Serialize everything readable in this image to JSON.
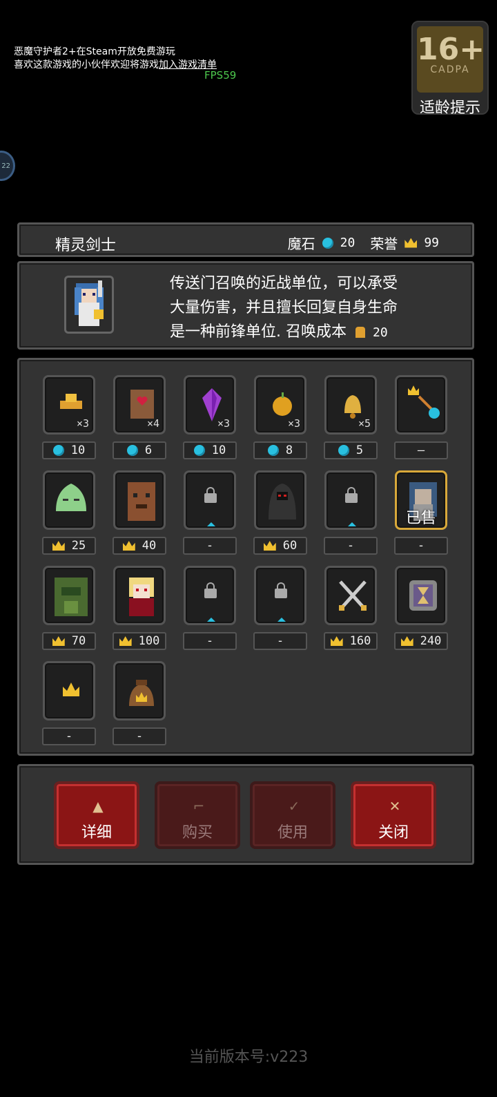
{
  "banner": {
    "line1": "恶魔守护者2+在Steam开放免费游玩",
    "line2_prefix": "喜欢这款游戏的小伙伴欢迎将游戏",
    "line2_link": "加入游戏清单",
    "fps": "FPS59"
  },
  "age_rating": {
    "number": "16+",
    "org": "CADPA",
    "tip": "适龄提示"
  },
  "side_bubble": "22",
  "header": {
    "unit_name": "精灵剑士",
    "magic_stone_label": "魔石",
    "magic_stone_value": "20",
    "honor_label": "荣誉",
    "honor_value": "99"
  },
  "description": {
    "line1": "传送门召唤的近战单位，可以承受",
    "line2": "大量伤害，并且擅长回复自身生命",
    "line3": "是一种前锋单位. 召唤成本",
    "cost": "20"
  },
  "items": [
    {
      "name": "gold-ingots",
      "qty": "×3",
      "currency": "gem",
      "price": "10"
    },
    {
      "name": "heart-scroll",
      "qty": "×4",
      "currency": "gem",
      "price": "6"
    },
    {
      "name": "purple-crystal",
      "qty": "×3",
      "currency": "gem",
      "price": "10"
    },
    {
      "name": "golden-apple",
      "qty": "×3",
      "currency": "gem",
      "price": "8"
    },
    {
      "name": "golden-bell",
      "qty": "×5",
      "currency": "gem",
      "price": "5"
    },
    {
      "name": "crown-to-gem-exchange",
      "qty": "",
      "currency": "none",
      "price": "—"
    },
    {
      "name": "green-slime",
      "qty": "",
      "currency": "crown",
      "price": "25"
    },
    {
      "name": "tree-stump",
      "qty": "",
      "currency": "crown",
      "price": "40"
    },
    {
      "name": "locked-slot",
      "qty": "",
      "currency": "none",
      "price": "-",
      "locked": true
    },
    {
      "name": "hooded-reaper",
      "qty": "",
      "currency": "crown",
      "price": "60"
    },
    {
      "name": "locked-slot",
      "qty": "",
      "currency": "none",
      "price": "-",
      "locked": true
    },
    {
      "name": "elf-swordsman",
      "qty": "",
      "currency": "none",
      "price": "-",
      "sold": "已售"
    },
    {
      "name": "leaf-golem",
      "qty": "",
      "currency": "crown",
      "price": "70"
    },
    {
      "name": "vampire-girl",
      "qty": "",
      "currency": "crown",
      "price": "100"
    },
    {
      "name": "locked-slot",
      "qty": "",
      "currency": "none",
      "price": "-",
      "locked": true
    },
    {
      "name": "locked-slot",
      "qty": "",
      "currency": "none",
      "price": "-",
      "locked": true
    },
    {
      "name": "crossed-swords",
      "qty": "",
      "currency": "crown",
      "price": "160"
    },
    {
      "name": "hourglass-frame",
      "qty": "",
      "currency": "crown",
      "price": "240"
    },
    {
      "name": "small-crown",
      "qty": "",
      "currency": "none",
      "price": "-"
    },
    {
      "name": "crown-bag",
      "qty": "",
      "currency": "none",
      "price": "-"
    }
  ],
  "buttons": {
    "detail": "详细",
    "buy": "购买",
    "use": "使用",
    "close": "关闭"
  },
  "version": "当前版本号:v223",
  "colors": {
    "gem": "#29c0e0",
    "crown": "#f0c030",
    "button_red": "#8b1515",
    "sold_border": "#d9a93a"
  }
}
